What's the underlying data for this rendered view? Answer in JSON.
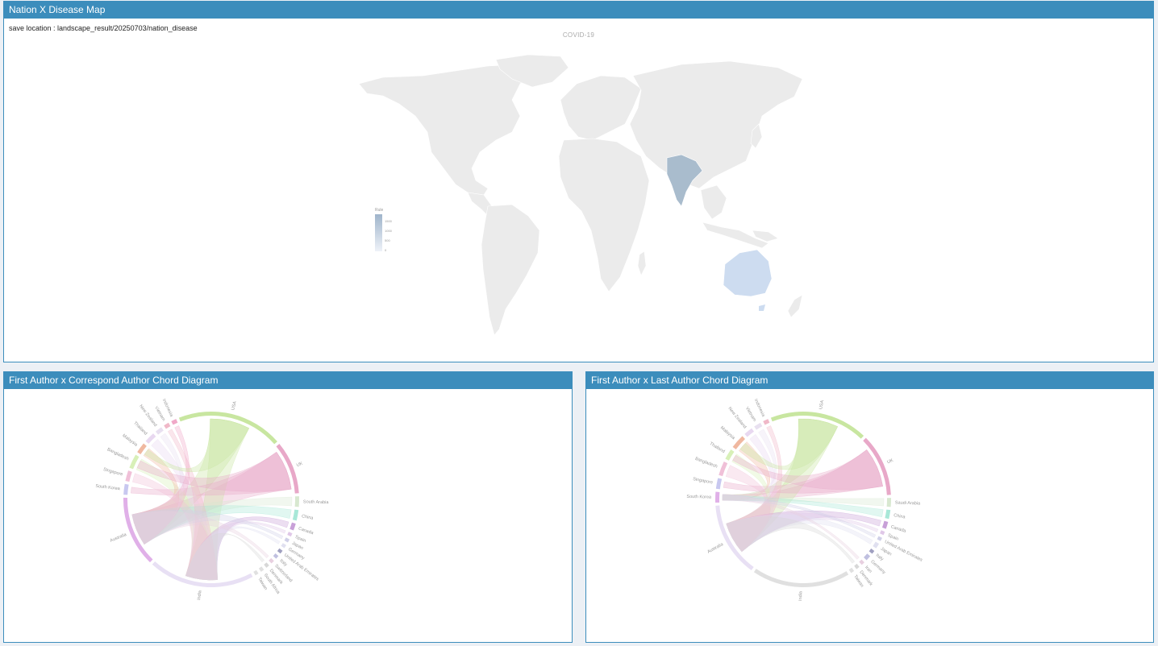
{
  "map_panel": {
    "title": "Nation X Disease Map",
    "save_location": "save location : landscape_result/20250703/nation_disease",
    "map_title": "COVID-19",
    "legend": {
      "label": "Rule",
      "ticks": [
        "1500",
        "1000",
        "500",
        "0"
      ],
      "color_low": "#eef2f8",
      "color_high": "#9fb4cb"
    },
    "highlighted": [
      {
        "name": "India",
        "color": "#a9bccd"
      },
      {
        "name": "Australia",
        "color": "#cddcf0"
      }
    ],
    "base_color": "#ebebeb"
  },
  "chord1": {
    "title": "First Author x Correspond Author Chord Diagram",
    "countries": [
      "USA",
      "UK",
      "South Arabia",
      "China",
      "Canada",
      "Spain",
      "Japan",
      "Germany",
      "United Arab Emirates",
      "Italy",
      "Switzerland",
      "Denmark",
      "South Africa",
      "Taiwan",
      "India",
      "Australia",
      "South Korea",
      "Singapore",
      "Bangladesh",
      "Malaysia",
      "Thailand",
      "New Zealand",
      "Vietnam",
      "Indonesia"
    ]
  },
  "chord2": {
    "title": "First Author x Last Author Chord Diagram",
    "countries": [
      "USA",
      "UK",
      "Saudi Arabia",
      "China",
      "Canada",
      "Spain",
      "United Arab Emirates",
      "Japan",
      "Italy",
      "Germany",
      "Iran",
      "Denmark",
      "Taiwan",
      "India",
      "Australia",
      "South Korea",
      "Singapore",
      "Bangladesh",
      "Thailand",
      "Malaysia",
      "New Zealand",
      "Vietnam",
      "Indonesia"
    ]
  }
}
